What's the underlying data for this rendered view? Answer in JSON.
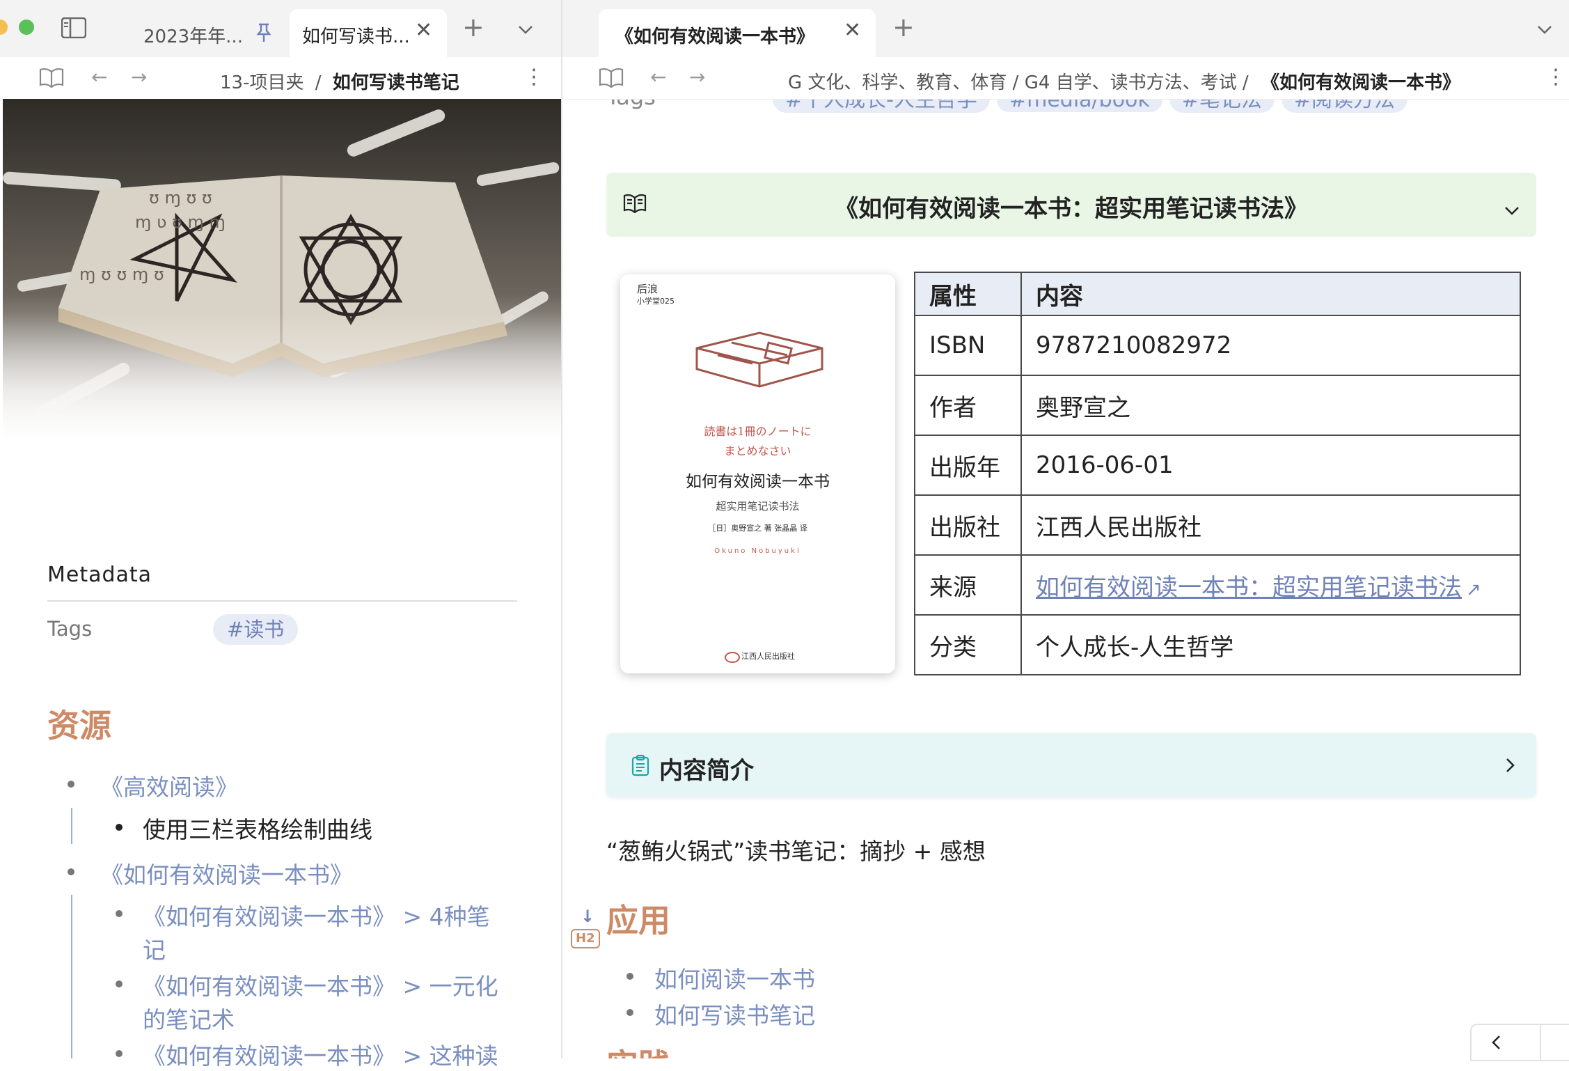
{
  "left_tabs": {
    "tab1": "2023年年...",
    "tab2": "如何写读书..."
  },
  "right_tabs": {
    "tab1": "《如何有效阅读一本书》"
  },
  "left_nav": {
    "path": "13-项目夹",
    "separator": "/",
    "current": "如何写读书笔记"
  },
  "right_nav": {
    "path": "G 文化、科学、教育、体育 / G4 自学、读书方法、考试 /",
    "current": "《如何有效阅读一本书》"
  },
  "left_note": {
    "metadata_label": "Metadata",
    "tags_label": "Tags",
    "tag": "#读书",
    "section_title": "资源",
    "items": [
      {
        "link": "《高效阅读》",
        "children": [
          "使用三栏表格绘制曲线"
        ]
      },
      {
        "link": "《如何有效阅读一本书》",
        "children": [
          {
            "line1": "《如何有效阅读一本书》 > 4种笔",
            "line2": "记"
          },
          {
            "line1": "《如何有效阅读一本书》 > 一元化",
            "line2": "的笔记术"
          },
          {
            "line1": "《如何有效阅读一本书》 > 这种读",
            "line2": ""
          }
        ]
      }
    ]
  },
  "right_note": {
    "tags_row": {
      "label": "Tags",
      "tags": [
        "#个人成长-人生哲学",
        "#media/book",
        "#笔记法",
        "#阅读方法"
      ]
    },
    "book_callout_title": "《如何有效阅读一本书：超实用笔记读书法》",
    "cover": {
      "publisher_top": "后浪",
      "series": "小学堂025",
      "jp_line1": "読書は1冊のノートに",
      "jp_line2": "まとめなさい",
      "title": "如何有效阅读一本书",
      "subtitle": "超实用笔记读书法",
      "authors": "［日］奥野宣之 著 张晶晶 译",
      "romaji": "Okuno Nobuyuki",
      "publisher_bottom": "江西人民出版社"
    },
    "table": {
      "headers": [
        "属性",
        "内容"
      ],
      "rows": [
        {
          "k": "ISBN",
          "v": "9787210082972"
        },
        {
          "k": "作者",
          "v": "奥野宣之"
        },
        {
          "k": "出版年",
          "v": "2016-06-01"
        },
        {
          "k": "出版社",
          "v": "江西人民出版社"
        },
        {
          "k": "来源",
          "v": "如何有效阅读一本书：超实用笔记读书法"
        },
        {
          "k": "分类",
          "v": "个人成长-人生哲学"
        }
      ]
    },
    "summary_callout_title": "内容简介",
    "body_text": "“葱鲔火锅式”读书笔记：摘抄 + 感想",
    "heading_badge": "H2",
    "heading": "应用",
    "apply_items": [
      "如何阅读一本书",
      "如何写读书笔记"
    ],
    "next_heading_partial": "实践"
  },
  "colors": {
    "accent_orange": "#cd8a66",
    "link_blue": "#7a8fc0",
    "callout_green": "#e9f6e6",
    "callout_teal": "#e6f5f5"
  }
}
